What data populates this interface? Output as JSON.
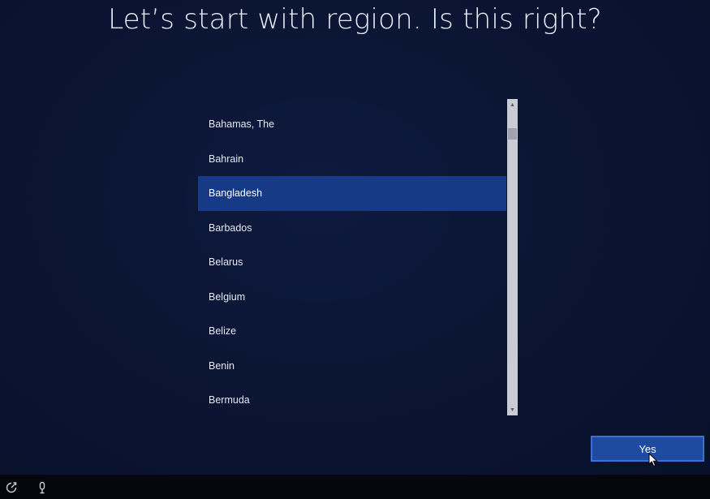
{
  "header": {
    "title": "Let’s start with region. Is this right?"
  },
  "region_list": {
    "items": [
      {
        "label": "Bahamas, The"
      },
      {
        "label": "Bahrain"
      },
      {
        "label": "Bangladesh"
      },
      {
        "label": "Barbados"
      },
      {
        "label": "Belarus"
      },
      {
        "label": "Belgium"
      },
      {
        "label": "Belize"
      },
      {
        "label": "Benin"
      },
      {
        "label": "Bermuda"
      }
    ],
    "selected": "Bangladesh"
  },
  "scrollbar": {
    "up_icon": "chevron-up-icon",
    "down_icon": "chevron-down-icon"
  },
  "footer": {
    "yes_label": "Yes"
  },
  "taskbar": {
    "icons": [
      "ease-of-access-icon",
      "microphone-icon"
    ]
  },
  "colors": {
    "background": "#0b1534",
    "selection": "#173a87",
    "button": "#1e4aa0",
    "button_border": "#3f6fd0",
    "scrollbar": "#c9ccd3",
    "taskbar": "#06070d"
  }
}
